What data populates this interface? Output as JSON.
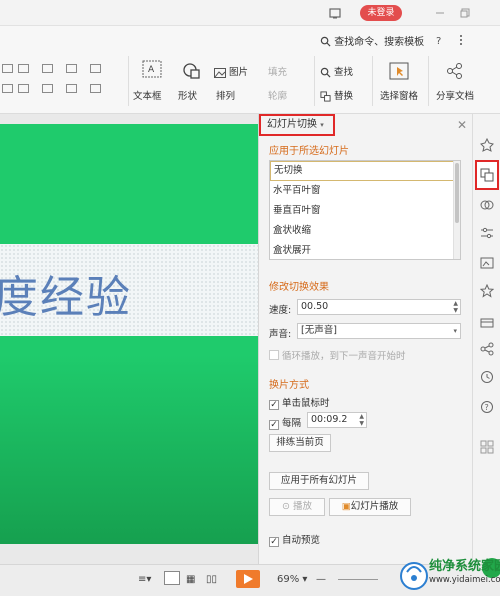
{
  "titlebar": {
    "login_label": "未登录"
  },
  "toolbar": {
    "search_command_label": "查找命令、搜索模板",
    "textbox_label": "文本框",
    "shape_label": "形状",
    "picture_label": "图片",
    "fill_label": "填充",
    "arrange_label": "排列",
    "outline_label": "轮廓",
    "find_label": "查找",
    "replace_label": "替换",
    "select_pane_label": "选择窗格",
    "share_doc_label": "分享文档"
  },
  "slide": {
    "text": "度经验"
  },
  "pane": {
    "title": "幻灯片切换",
    "apply_section": "应用于所选幻灯片",
    "transitions": [
      "无切换",
      "水平百叶窗",
      "垂直百叶窗",
      "盒状收缩",
      "盒状展开"
    ],
    "modify_section": "修改切换效果",
    "speed_label": "速度:",
    "speed_value": "00.50",
    "sound_label": "声音:",
    "sound_value": "[无声音]",
    "loop_label": "循环播放，到下一声音开始时",
    "advance_section": "换片方式",
    "on_click_label": "单击鼠标时",
    "every_label": "每隔",
    "every_value": "00:09.2",
    "rehearse_label": "排练当前页",
    "apply_all_label": "应用于所有幻灯片",
    "play_label": "播放",
    "slideshow_label": "幻灯片播放",
    "autopreview_label": "自动预览"
  },
  "statusbar": {
    "zoom": "69%",
    "zoom_minus": "—"
  },
  "watermark": {
    "title": "纯净系统家园",
    "url": "www.yidaimei.com"
  },
  "colors": {
    "accent_orange": "#d66b1b",
    "highlight_red": "#e02828",
    "slide_green": "#1fcb6c",
    "slide_text_blue": "#5b80b9",
    "login_red": "#e34d4d",
    "play_orange": "#f07b2c"
  },
  "icons": [
    "monitor-icon",
    "minimize-icon",
    "maximize-icon",
    "search-icon",
    "help-icon",
    "more-icon",
    "textbox-icon",
    "shape-icon",
    "picture-icon",
    "find-icon",
    "replace-icon",
    "select-pane-icon",
    "share-icon",
    "close-icon",
    "pin-icon",
    "transition-icon",
    "animation-icon",
    "settings-icon",
    "slides-icon",
    "star-icon",
    "gift-icon",
    "share-side-icon",
    "history-icon",
    "help-side-icon",
    "grid-icon",
    "normal-view-icon",
    "sorter-view-icon",
    "reading-view-icon",
    "slideshow-play-icon"
  ]
}
